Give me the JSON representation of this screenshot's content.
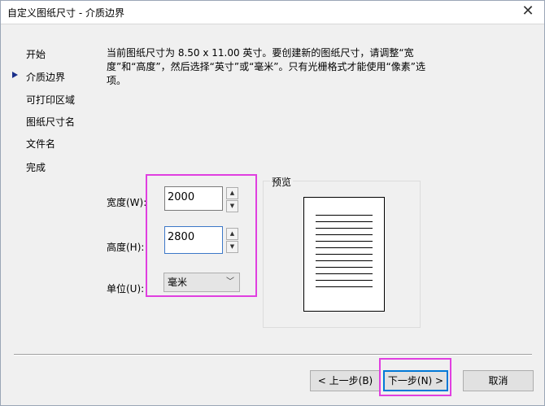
{
  "window": {
    "title": "自定义图纸尺寸 - 介质边界"
  },
  "nav": {
    "items": [
      {
        "label": "开始"
      },
      {
        "label": "介质边界"
      },
      {
        "label": "可打印区域"
      },
      {
        "label": "图纸尺寸名"
      },
      {
        "label": "文件名"
      },
      {
        "label": "完成"
      }
    ],
    "current_index": 1
  },
  "description": "当前图纸尺寸为 8.50 x 11.00 英寸。要创建新的图纸尺寸，请调整“宽度”和“高度”，然后选择“英寸”或“毫米”。只有光栅格式才能使用“像素”选项。",
  "form": {
    "width": {
      "label": "宽度(W):",
      "value": "2000"
    },
    "height": {
      "label": "高度(H):",
      "value": "2800"
    },
    "units": {
      "label": "单位(U):",
      "selected": "毫米"
    }
  },
  "preview": {
    "label": "预览"
  },
  "buttons": {
    "back": "< 上一步(B)",
    "next": "下一步(N) >",
    "cancel": "取消"
  },
  "colors": {
    "highlight": "#e03fe0",
    "focus": "#3c78c8",
    "nav_marker": "#1a2f8a"
  }
}
